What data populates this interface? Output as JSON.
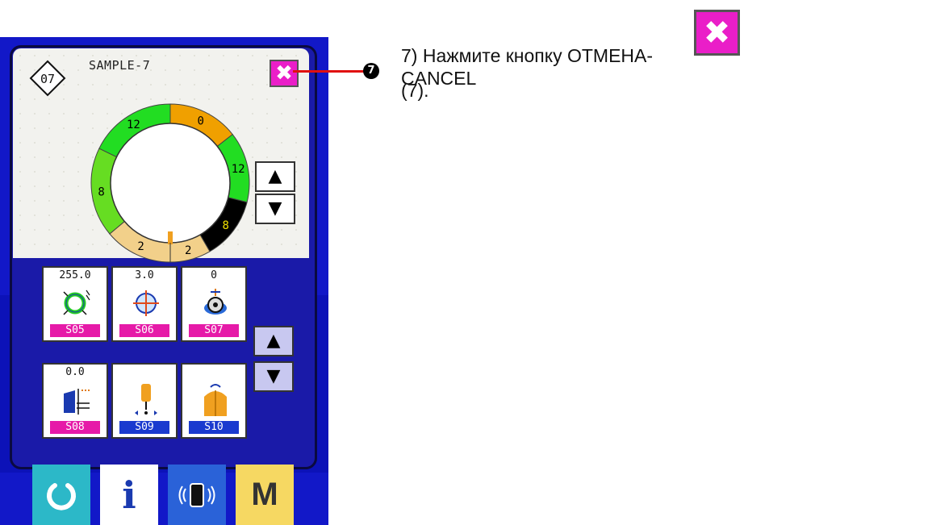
{
  "screen": {
    "pattern_number": "07",
    "pattern_name": "SAMPLE-7",
    "cancel_glyph": "✖",
    "ring_segments": [
      {
        "label": "0",
        "color": "#f0a000",
        "text_color": "#000000"
      },
      {
        "label": "12",
        "color": "#22dd22",
        "text_color": "#000000"
      },
      {
        "label": "8",
        "color": "#000000",
        "text_color": "#f0e000"
      },
      {
        "label": "2",
        "color": "#f2d08a",
        "text_color": "#000000"
      },
      {
        "label": "2",
        "color": "#f2d08a",
        "text_color": "#000000"
      },
      {
        "label": "8",
        "color": "#66dd22",
        "text_color": "#000000"
      },
      {
        "label": "12",
        "color": "#22dd22",
        "text_color": "#000000"
      }
    ],
    "upper_up_arrow": "▲",
    "upper_down_arrow": "▼",
    "params": [
      {
        "value": "255.0",
        "code": "S05",
        "code_style": "pink",
        "icon": "cut-length-icon"
      },
      {
        "value": "3.0",
        "code": "S06",
        "code_style": "pink",
        "icon": "crosshair-position-icon"
      },
      {
        "value": "0",
        "code": "S07",
        "code_style": "pink",
        "icon": "thread-tension-icon"
      },
      {
        "value": "0.0",
        "code": "S08",
        "code_style": "pink",
        "icon": "knife-offset-icon"
      },
      {
        "value": "",
        "code": "S09",
        "code_style": "blue",
        "icon": "needle-icon"
      },
      {
        "value": "",
        "code": "S10",
        "code_style": "blue",
        "icon": "presser-foot-icon"
      }
    ],
    "lower_up_arrow": "▲",
    "lower_down_arrow": "▼",
    "tabs": {
      "ready_icon": "ready-circle-icon",
      "info_label": "i",
      "comm_icon": "communication-icon",
      "mode_label": "M"
    }
  },
  "callout": {
    "marker": "7"
  },
  "instruction": {
    "line1": "7) Нажмите кнопку ОТМЕНА-CANCEL",
    "line2": "(7).",
    "icon_glyph": "✖"
  },
  "colors": {
    "device_blue": "#1218c8",
    "cancel_pink": "#ea1ec8",
    "code_pink": "#e61aa8",
    "code_blue": "#1a3acf"
  }
}
